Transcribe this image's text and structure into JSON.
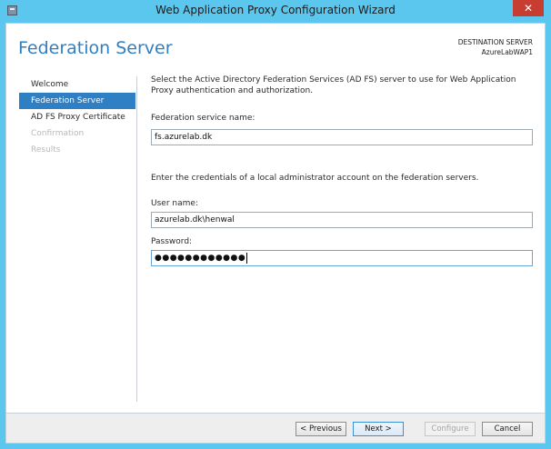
{
  "window": {
    "title": "Web Application Proxy Configuration Wizard",
    "close_glyph": "✕"
  },
  "page": {
    "title": "Federation Server"
  },
  "destination": {
    "label": "DESTINATION SERVER",
    "server": "AzureLabWAP1"
  },
  "nav": {
    "items": [
      {
        "label": "Welcome",
        "state": "normal"
      },
      {
        "label": "Federation Server",
        "state": "selected"
      },
      {
        "label": "AD FS Proxy Certificate",
        "state": "normal"
      },
      {
        "label": "Confirmation",
        "state": "disabled"
      },
      {
        "label": "Results",
        "state": "disabled"
      }
    ]
  },
  "content": {
    "description": "Select the Active Directory Federation Services (AD FS) server to use for Web Application Proxy authentication and authorization.",
    "federation_label": "Federation service name:",
    "federation_value": "fs.azurelab.dk",
    "credentials_text": "Enter the credentials of a local administrator account on the federation servers.",
    "username_label": "User name:",
    "username_value": "azurelab.dk\\henwal",
    "password_label": "Password:",
    "password_value": "●●●●●●●●●●●●"
  },
  "buttons": {
    "previous": "< Previous",
    "next": "Next >",
    "configure": "Configure",
    "cancel": "Cancel"
  },
  "colors": {
    "accent": "#2f7fc4",
    "frame": "#5cc7ee",
    "close": "#c73d31"
  }
}
